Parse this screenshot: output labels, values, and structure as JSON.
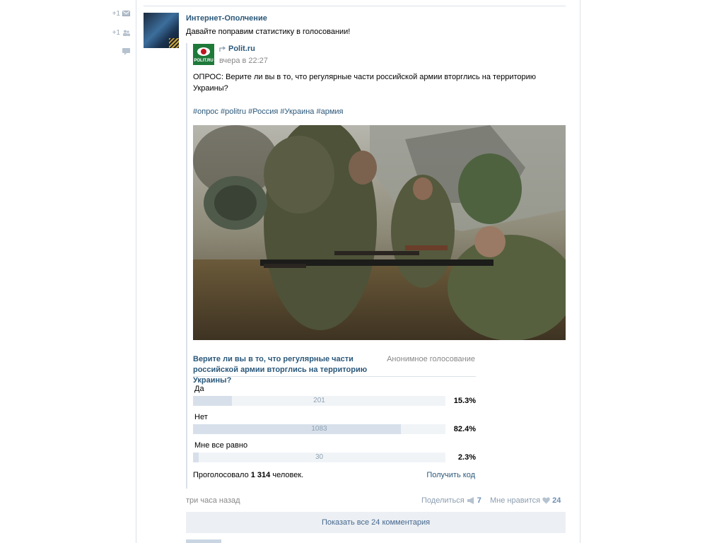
{
  "side_actions": [
    {
      "count": "+1",
      "icon": "mail-icon"
    },
    {
      "count": "+1",
      "icon": "users-icon"
    },
    {
      "count": "",
      "icon": "comment-icon"
    }
  ],
  "post": {
    "author": "Интернет-Ополчение",
    "text": "Давайте поправим статистику в голосовании!",
    "time": "три часа назад"
  },
  "repost": {
    "source": "Polit.ru",
    "logo_text": "POLIT.RU",
    "time": "вчера в 22:27",
    "text": "ОПРОС: Верите ли вы в то, что регулярные части российской армии вторглись на территорию Украины?",
    "hashtags": [
      "#опрос",
      "#politru",
      "#Россия",
      "#Украина",
      "#армия"
    ]
  },
  "poll": {
    "question": "Верите ли вы в то, что регулярные части российской армии вторглись на территорию Украины?",
    "type_label": "Анонимное голосование",
    "options": [
      {
        "label": "Да",
        "votes": "201",
        "percent": "15.3%",
        "fraction": 0.153
      },
      {
        "label": "Нет",
        "votes": "1083",
        "percent": "82.4%",
        "fraction": 0.824
      },
      {
        "label": "Мне все равно",
        "votes": "30",
        "percent": "2.3%",
        "fraction": 0.023
      }
    ],
    "voted_prefix": "Проголосовало",
    "voted_count": "1 314",
    "voted_suffix": "человек.",
    "get_code_label": "Получить код"
  },
  "actions": {
    "share_label": "Поделиться",
    "share_count": "7",
    "like_label": "Мне нравится",
    "like_count": "24"
  },
  "comments_button": "Показать все 24 комментария",
  "colors": {
    "link": "#2b587a",
    "bar_fill": "#d7e0ea",
    "bar_bg": "#f1f4f7",
    "button_bg": "#eceff3"
  }
}
